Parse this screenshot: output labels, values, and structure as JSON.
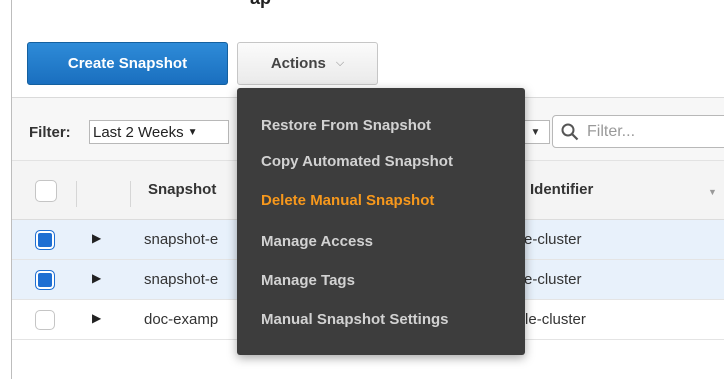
{
  "toolbar": {
    "create_label": "Create Snapshot",
    "actions_label": "Actions",
    "top_partial": "ap"
  },
  "filter": {
    "label": "Filter:",
    "range_value": "Last 2 Weeks",
    "search_placeholder": "Filter..."
  },
  "table": {
    "columns": [
      "Snapshot",
      "Identifier"
    ],
    "rows": [
      {
        "selected": true,
        "snapshot": "snapshot-e",
        "cluster": "e-cluster"
      },
      {
        "selected": true,
        "snapshot": "snapshot-e",
        "cluster": "e-cluster"
      },
      {
        "selected": false,
        "snapshot": "doc-examp",
        "cluster": "example-cluster"
      }
    ]
  },
  "actions_menu": {
    "items": [
      "Restore From Snapshot",
      "Copy Automated Snapshot",
      "Delete Manual Snapshot",
      "Manage Access",
      "Manage Tags",
      "Manual Snapshot Settings"
    ],
    "highlighted": "Delete Manual Snapshot"
  },
  "colors": {
    "primary": "#1a6fbf",
    "menu_bg": "#3d3d3d",
    "menu_highlight": "#f7981c",
    "selected_row": "#e8f1fb"
  }
}
